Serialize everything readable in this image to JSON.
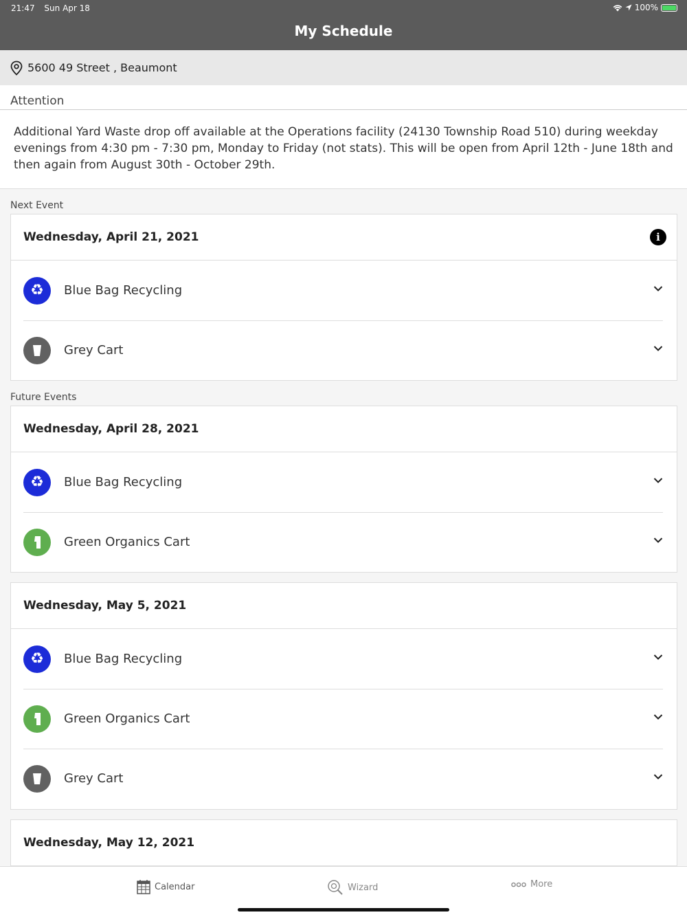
{
  "status_bar": {
    "time": "21:47",
    "date": "Sun Apr 18",
    "battery": "100%"
  },
  "header": {
    "title": "My Schedule"
  },
  "address": {
    "text": "5600 49 Street , Beaumont"
  },
  "attention": {
    "heading": "Attention",
    "body": "Additional Yard Waste drop off available at the Operations facility (24130 Township Road 510) during weekday evenings from 4:30 pm - 7:30 pm, Monday to Friday (not stats).  This will be open from April 12th - June 18th and then again from August 30th - October 29th."
  },
  "next_event": {
    "label": "Next Event",
    "date": "Wednesday, April 21, 2021",
    "items": [
      {
        "label": "Blue Bag Recycling",
        "icon": "recycle-icon"
      },
      {
        "label": "Grey Cart",
        "icon": "grey-cart-icon"
      }
    ]
  },
  "future_events": {
    "label": "Future Events",
    "events": [
      {
        "date": "Wednesday, April 28, 2021",
        "items": [
          {
            "label": "Blue Bag Recycling",
            "icon": "recycle-icon"
          },
          {
            "label": "Green Organics Cart",
            "icon": "green-cart-icon"
          }
        ]
      },
      {
        "date": "Wednesday, May 5, 2021",
        "items": [
          {
            "label": "Blue Bag Recycling",
            "icon": "recycle-icon"
          },
          {
            "label": "Green Organics Cart",
            "icon": "green-cart-icon"
          },
          {
            "label": "Grey Cart",
            "icon": "grey-cart-icon"
          }
        ]
      },
      {
        "date": "Wednesday, May 12, 2021",
        "items": []
      }
    ]
  },
  "tabs": [
    {
      "label": "Calendar",
      "icon": "calendar-icon"
    },
    {
      "label": "Wizard",
      "icon": "wizard-icon"
    },
    {
      "label": "More",
      "icon": "more-icon"
    }
  ],
  "colors": {
    "header": "#5b5b5b",
    "recycle": "#1c2cd8",
    "grey_cart": "#616161",
    "green_cart": "#5fae4f"
  }
}
